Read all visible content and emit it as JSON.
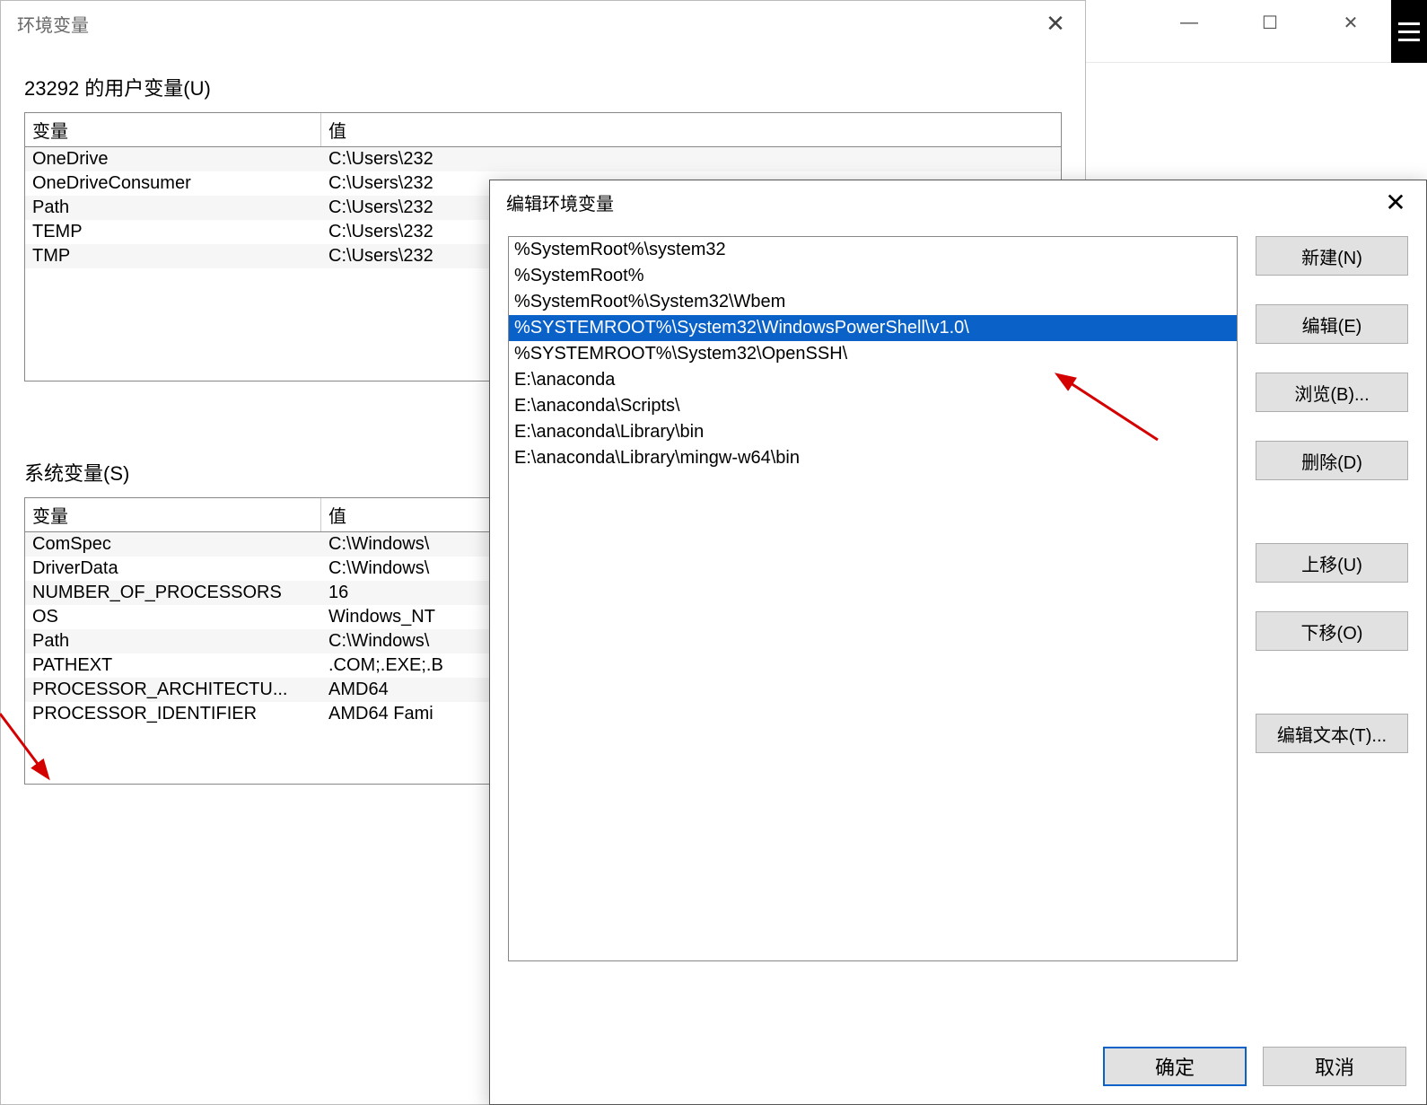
{
  "bg_window": {
    "minimize": "—",
    "maximize": "☐",
    "close": "✕"
  },
  "env_dialog": {
    "title": "环境变量",
    "close": "✕",
    "user_section_label": "23292 的用户变量(U)",
    "system_section_label": "系统变量(S)",
    "col_name": "变量",
    "col_value": "值",
    "user_vars": [
      {
        "name": "OneDrive",
        "value": "C:\\Users\\232"
      },
      {
        "name": "OneDriveConsumer",
        "value": "C:\\Users\\232"
      },
      {
        "name": "Path",
        "value": "C:\\Users\\232"
      },
      {
        "name": "TEMP",
        "value": "C:\\Users\\232"
      },
      {
        "name": "TMP",
        "value": "C:\\Users\\232"
      }
    ],
    "system_vars": [
      {
        "name": "ComSpec",
        "value": "C:\\Windows\\"
      },
      {
        "name": "DriverData",
        "value": "C:\\Windows\\"
      },
      {
        "name": "NUMBER_OF_PROCESSORS",
        "value": "16"
      },
      {
        "name": "OS",
        "value": "Windows_NT"
      },
      {
        "name": "Path",
        "value": "C:\\Windows\\"
      },
      {
        "name": "PATHEXT",
        "value": ".COM;.EXE;.B"
      },
      {
        "name": "PROCESSOR_ARCHITECTU...",
        "value": "AMD64"
      },
      {
        "name": "PROCESSOR_IDENTIFIER",
        "value": "AMD64 Fami"
      }
    ]
  },
  "edit_dialog": {
    "title": "编辑环境变量",
    "close": "✕",
    "path_items": [
      {
        "text": "%SystemRoot%\\system32",
        "selected": false
      },
      {
        "text": "%SystemRoot%",
        "selected": false
      },
      {
        "text": "%SystemRoot%\\System32\\Wbem",
        "selected": false
      },
      {
        "text": "%SYSTEMROOT%\\System32\\WindowsPowerShell\\v1.0\\",
        "selected": true
      },
      {
        "text": "%SYSTEMROOT%\\System32\\OpenSSH\\",
        "selected": false
      },
      {
        "text": "E:\\anaconda",
        "selected": false
      },
      {
        "text": "E:\\anaconda\\Scripts\\",
        "selected": false
      },
      {
        "text": "E:\\anaconda\\Library\\bin",
        "selected": false
      },
      {
        "text": "E:\\anaconda\\Library\\mingw-w64\\bin",
        "selected": false
      }
    ],
    "buttons": {
      "new": "新建(N)",
      "edit": "编辑(E)",
      "browse": "浏览(B)...",
      "delete": "删除(D)",
      "move_up": "上移(U)",
      "move_down": "下移(O)",
      "edit_text": "编辑文本(T)...",
      "ok": "确定",
      "cancel": "取消"
    }
  }
}
